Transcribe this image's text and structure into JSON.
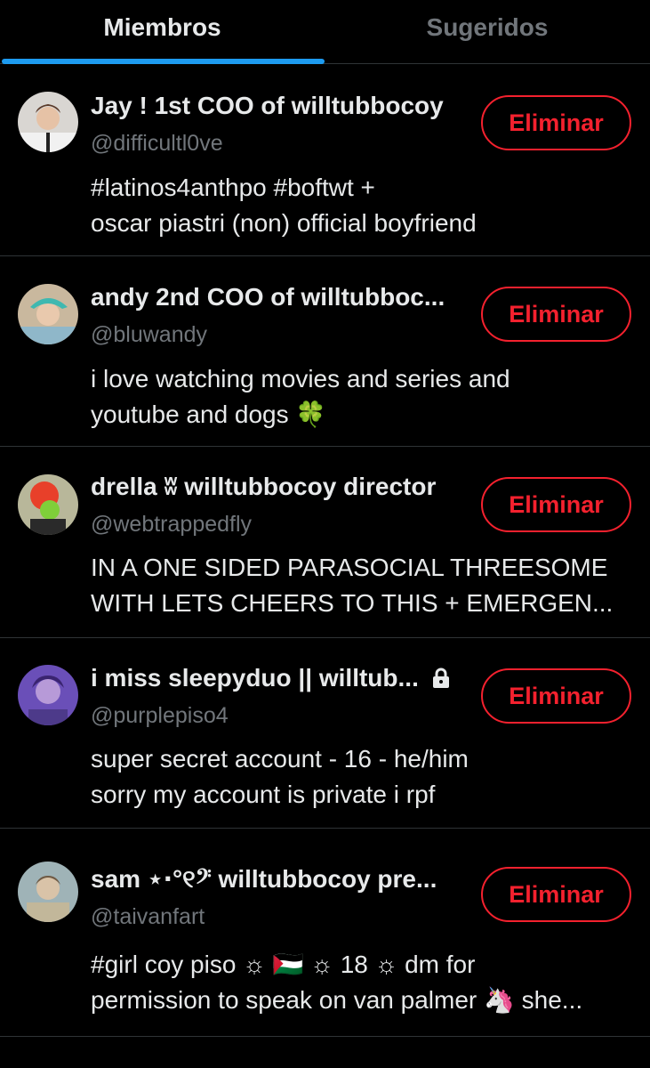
{
  "tabs": {
    "members": "Miembros",
    "suggested": "Sugeridos"
  },
  "accent_color": "#1d9bf0",
  "danger_color": "#f4212e",
  "members": [
    {
      "name": "Jay ! 1st COO of willtubbocoy",
      "handle": "@difficultl0ve",
      "bio": [
        "#latinos4anthpo #boftwt +",
        "oscar piastri (non) official boyfriend"
      ],
      "button": "Eliminar"
    },
    {
      "name": "andy 2nd COO of willtubboc...",
      "handle": "@bluwandy",
      "bio": [
        "i love watching movies and series and",
        "youtube and dogs 🍀"
      ],
      "button": "Eliminar"
    },
    {
      "name": "drella ʬ willtubbocoy director",
      "handle": "@webtrappedfly",
      "bio": [
        "IN A ONE SIDED PARASOCIAL THREESOME",
        "WITH LETS CHEERS TO THIS + EMERGEN..."
      ],
      "button": "Eliminar"
    },
    {
      "name": "i miss sleepyduo || willtub...",
      "handle": "@purplepiso4",
      "bio": [
        "super secret account - 16 - he/him",
        "sorry my account is private i rpf"
      ],
      "button": "Eliminar",
      "protected_icon": "lock-icon"
    },
    {
      "name": "sam ⋆⋅°୧𝄢 willtubbocoy pre...",
      "handle": "@taivanfart",
      "bio": [
        "#girl coy piso ☼ 🇵🇸 ☼ 18 ☼ dm for",
        "permission to speak on van palmer 🦄 she..."
      ],
      "button": "Eliminar"
    }
  ]
}
